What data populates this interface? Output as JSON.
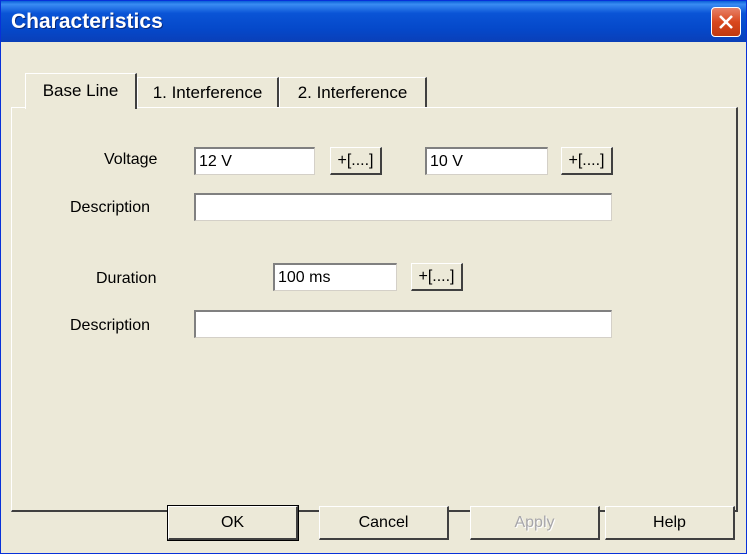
{
  "window": {
    "title": "Characteristics"
  },
  "tabs": [
    {
      "label": "Base Line",
      "active": true
    },
    {
      "label": "1. Interference",
      "active": false
    },
    {
      "label": "2. Interference",
      "active": false
    }
  ],
  "voltage": {
    "label": "Voltage",
    "value1": "12 V",
    "value2": "10 V",
    "add_label": "+[....]"
  },
  "description1": {
    "label": "Description",
    "value": ""
  },
  "duration": {
    "label": "Duration",
    "value": "100 ms",
    "add_label": "+[....]"
  },
  "description2": {
    "label": "Description",
    "value": ""
  },
  "buttons": {
    "ok": "OK",
    "cancel": "Cancel",
    "apply": "Apply",
    "help": "Help",
    "apply_enabled": false
  }
}
